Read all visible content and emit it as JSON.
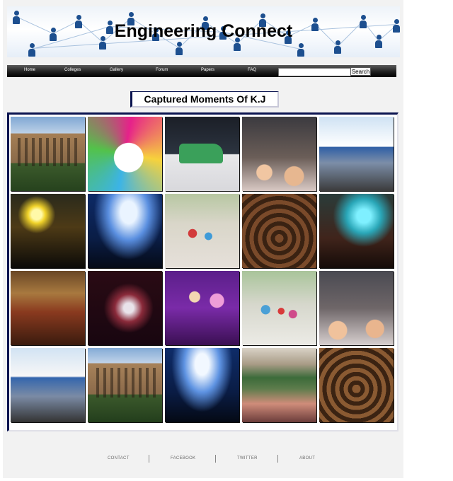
{
  "banner": {
    "title": "Engineering Connect"
  },
  "nav": {
    "items": [
      {
        "label": "Home"
      },
      {
        "label": "Colleges"
      },
      {
        "label": "Gallery"
      },
      {
        "label": "Forum"
      },
      {
        "label": "Papers"
      },
      {
        "label": "FAQ"
      }
    ],
    "search_value": "",
    "search_button": "Search"
  },
  "heading": "Captured Moments Of K.J",
  "gallery": {
    "photos": [
      "building-photo",
      "fest-poster-photo",
      "race-car-photo",
      "crowd-photo",
      "campus-photo",
      "night-lights-photo",
      "concert-photo",
      "dance-photo",
      "crowd-photo",
      "stage-photo",
      "auditorium-photo",
      "stage-performer-photo",
      "performers-photo",
      "dance-photo",
      "crowd-photo",
      "campus-photo",
      "building-photo",
      "concert-photo",
      "courtyard-crowd-photo",
      "crowd-photo"
    ]
  },
  "footer": {
    "links": [
      {
        "label": "CONTACT"
      },
      {
        "label": "FACEBOOK"
      },
      {
        "label": "TWITTER"
      },
      {
        "label": "ABOUT"
      }
    ]
  }
}
